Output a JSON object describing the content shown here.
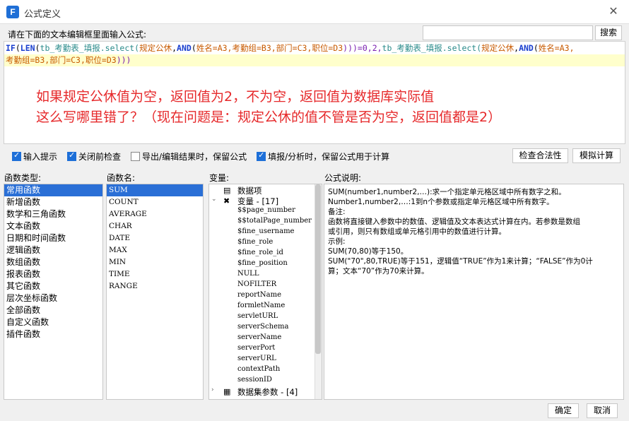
{
  "window": {
    "title": "公式定义",
    "app_icon": "fanruan-logo-icon",
    "close_icon": "close-icon"
  },
  "prompt": "请在下面的文本编辑框里面输入公式:",
  "search": {
    "placeholder": "",
    "button": "搜索"
  },
  "formula_line1_parts": [
    {
      "t": "IF",
      "c": "kw"
    },
    {
      "t": "(",
      "c": "cursor"
    },
    {
      "t": "LEN",
      "c": "kw"
    },
    {
      "t": "(",
      "c": ""
    },
    {
      "t": "tb_考勤表_填报",
      "c": "id"
    },
    {
      "t": ".select(",
      "c": "id"
    },
    {
      "t": "规定公休",
      "c": "hz"
    },
    {
      "t": ",",
      "c": ""
    },
    {
      "t": "AND",
      "c": "kw"
    },
    {
      "t": "(",
      "c": ""
    },
    {
      "t": "姓名=A3,",
      "c": "hz"
    },
    {
      "t": "考勤组=B3,",
      "c": "hz"
    },
    {
      "t": "部门=C3,",
      "c": "hz"
    },
    {
      "t": "职位=D3",
      "c": "hz"
    },
    {
      "t": ")))=0,2,",
      "c": "pu"
    },
    {
      "t": "tb_考勤表_填报",
      "c": "id"
    },
    {
      "t": ".select(",
      "c": "id"
    },
    {
      "t": "规定公休",
      "c": "hz"
    },
    {
      "t": ",",
      "c": ""
    },
    {
      "t": "AND",
      "c": "kw"
    },
    {
      "t": "(",
      "c": ""
    },
    {
      "t": "姓名=A3,",
      "c": "hz"
    }
  ],
  "formula_line2_parts": [
    {
      "t": "考勤组=B3,",
      "c": "hz"
    },
    {
      "t": "部门=C3,",
      "c": "hz"
    },
    {
      "t": "职位=D3",
      "c": "hz"
    },
    {
      "t": ")))",
      "c": "pu"
    }
  ],
  "annotation": {
    "line1": "如果规定公休值为空，返回值为2，不为空，返回值为数据库实际值",
    "line2": "这么写哪里错了？（现在问题是：规定公休的值不管是否为空，返回值都是2）"
  },
  "options": [
    {
      "label": "输入提示",
      "checked": true
    },
    {
      "label": "关闭前检查",
      "checked": true
    },
    {
      "label": "导出/编辑结果时，保留公式",
      "checked": false
    },
    {
      "label": "填报/分析时，保留公式用于计算",
      "checked": true
    }
  ],
  "buttons": {
    "validate": "检查合法性",
    "simulate": "模拟计算",
    "ok": "确定",
    "cancel": "取消"
  },
  "labels": {
    "fn_type": "函数类型:",
    "fn_name": "函数名:",
    "vars": "变量:",
    "desc": "公式说明:"
  },
  "fn_types": [
    "常用函数",
    "新增函数",
    "数学和三角函数",
    "文本函数",
    "日期和时间函数",
    "逻辑函数",
    "数组函数",
    "报表函数",
    "其它函数",
    "层次坐标函数",
    "全部函数",
    "自定义函数",
    "插件函数"
  ],
  "fn_types_selected": 0,
  "fn_names": [
    "SUM",
    "COUNT",
    "AVERAGE",
    "CHAR",
    "DATE",
    "MAX",
    "MIN",
    "TIME",
    "RANGE"
  ],
  "fn_names_selected": 0,
  "vars_tree": [
    {
      "text": "数据项",
      "kind": "dataset",
      "icon": "table-icon",
      "toggle": ""
    },
    {
      "text": "变量 - [17]",
      "kind": "group",
      "icon": "variable-icon",
      "toggle": "⌄"
    },
    {
      "text": "$$page_number",
      "kind": "item"
    },
    {
      "text": "$$totalPage_number",
      "kind": "item"
    },
    {
      "text": "$fine_username",
      "kind": "item"
    },
    {
      "text": "$fine_role",
      "kind": "item"
    },
    {
      "text": "$fine_role_id",
      "kind": "item"
    },
    {
      "text": "$fine_position",
      "kind": "item"
    },
    {
      "text": "NULL",
      "kind": "item"
    },
    {
      "text": "NOFILTER",
      "kind": "item"
    },
    {
      "text": "reportName",
      "kind": "item"
    },
    {
      "text": "formletName",
      "kind": "item"
    },
    {
      "text": "servletURL",
      "kind": "item"
    },
    {
      "text": "serverSchema",
      "kind": "item"
    },
    {
      "text": "serverName",
      "kind": "item"
    },
    {
      "text": "serverPort",
      "kind": "item"
    },
    {
      "text": "serverURL",
      "kind": "item"
    },
    {
      "text": "contextPath",
      "kind": "item"
    },
    {
      "text": "sessionID",
      "kind": "item"
    },
    {
      "text": "数据集参数 - [4]",
      "kind": "params",
      "icon": "params-icon",
      "toggle": "›"
    }
  ],
  "description": [
    "SUM(number1,number2,…):求一个指定单元格区域中所有数字之和。",
    "Number1,number2,…:1到n个参数或指定单元格区域中所有数字。",
    "备注:",
    "函数将直接键入参数中的数值、逻辑值及文本表达式计算在内。若参数是数组",
    "或引用，则只有数组或单元格引用中的数值进行计算。",
    "示例:",
    "SUM(70,80)等于150。",
    "SUM(\"70\",80,TRUE)等于151，逻辑值“TRUE”作为1来计算；“FALSE”作为0计",
    "算；文本“70”作为70来计算。"
  ]
}
